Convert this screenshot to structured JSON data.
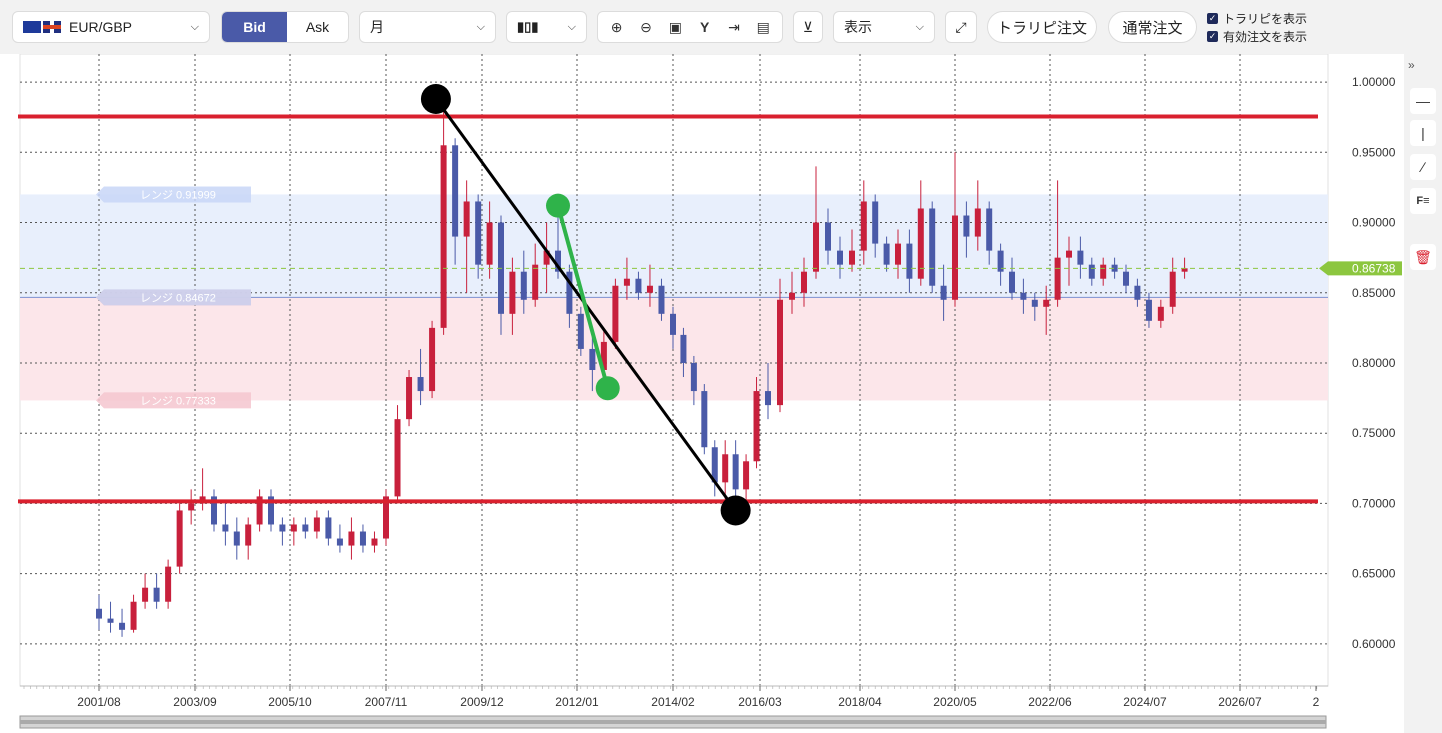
{
  "toolbar": {
    "symbol": "EUR/GBP",
    "bid_label": "Bid",
    "ask_label": "Ask",
    "period": "月",
    "display_label": "表示",
    "trap_order_label": "トラリピ注文",
    "normal_order_label": "通常注文",
    "show_trap_label": "トラリピを表示",
    "show_active_orders_label": "有効注文を表示",
    "show_trap_checked": true,
    "show_active_orders_checked": true
  },
  "colors": {
    "up_candle": "#c8203c",
    "down_candle": "#4a5aa8",
    "horizontal_line": "#d9202e",
    "trend_line": "#000000",
    "green_line": "#2fb34a",
    "price_tag": "#8cc63f",
    "range_band_blue": "#e8effc",
    "range_band_pink": "#fce6ea"
  },
  "chart_data": {
    "type": "candlestick",
    "symbol": "EUR/GBP",
    "timeframe": "月",
    "ylim": [
      0.57,
      1.02
    ],
    "y_ticks": [
      "1.00000",
      "0.95000",
      "0.90000",
      "0.85000",
      "0.80000",
      "0.75000",
      "0.70000",
      "0.65000",
      "0.60000"
    ],
    "x_ticks": [
      "2001/08",
      "2003/09",
      "2005/10",
      "2007/11",
      "2009/12",
      "2012/01",
      "2014/02",
      "2016/03",
      "2018/04",
      "2020/05",
      "2022/06",
      "2024/07",
      "2026/07",
      "2"
    ],
    "current_price": "0.86738",
    "range_labels": [
      {
        "text": "レンジ 0.91999",
        "value": 0.91999
      },
      {
        "text": "レンジ 0.84660",
        "value": 0.8466
      },
      {
        "text": "レンジ 0.84672",
        "value": 0.84672
      },
      {
        "text": "レンジ 0.77333",
        "value": 0.77333
      }
    ],
    "range_bands": [
      {
        "from": 0.8466,
        "to": 0.91999,
        "color": "blue"
      },
      {
        "from": 0.77333,
        "to": 0.8466,
        "color": "pink"
      }
    ],
    "horizontal_lines": [
      0.9755,
      0.7015
    ],
    "trend_lines": [
      {
        "from": [
          "2008/12",
          0.988
        ],
        "to": [
          "2015/08",
          0.695
        ],
        "color": "black",
        "end_markers": true
      },
      {
        "from": [
          "2011/08",
          0.912
        ],
        "to": [
          "2012/09",
          0.782
        ],
        "color": "green",
        "end_markers": true
      }
    ],
    "series": [
      {
        "name": "EUR/GBP",
        "ohlc": [
          [
            "2001/08",
            0.625,
            0.635,
            0.61,
            0.618
          ],
          [
            "2001/11",
            0.618,
            0.63,
            0.608,
            0.615
          ],
          [
            "2002/02",
            0.615,
            0.625,
            0.605,
            0.61
          ],
          [
            "2002/05",
            0.61,
            0.635,
            0.608,
            0.63
          ],
          [
            "2002/08",
            0.63,
            0.65,
            0.625,
            0.64
          ],
          [
            "2002/11",
            0.64,
            0.65,
            0.625,
            0.63
          ],
          [
            "2003/02",
            0.63,
            0.66,
            0.625,
            0.655
          ],
          [
            "2003/05",
            0.655,
            0.7,
            0.65,
            0.695
          ],
          [
            "2003/08",
            0.695,
            0.71,
            0.685,
            0.7
          ],
          [
            "2003/11",
            0.7,
            0.725,
            0.695,
            0.705
          ],
          [
            "2004/02",
            0.705,
            0.71,
            0.68,
            0.685
          ],
          [
            "2004/05",
            0.685,
            0.7,
            0.67,
            0.68
          ],
          [
            "2004/08",
            0.68,
            0.69,
            0.66,
            0.67
          ],
          [
            "2004/11",
            0.67,
            0.69,
            0.66,
            0.685
          ],
          [
            "2005/02",
            0.685,
            0.71,
            0.68,
            0.705
          ],
          [
            "2005/05",
            0.705,
            0.71,
            0.68,
            0.685
          ],
          [
            "2005/08",
            0.685,
            0.69,
            0.67,
            0.68
          ],
          [
            "2005/11",
            0.68,
            0.69,
            0.67,
            0.685
          ],
          [
            "2006/02",
            0.685,
            0.69,
            0.675,
            0.68
          ],
          [
            "2006/05",
            0.68,
            0.695,
            0.675,
            0.69
          ],
          [
            "2006/08",
            0.69,
            0.695,
            0.67,
            0.675
          ],
          [
            "2006/11",
            0.675,
            0.685,
            0.665,
            0.67
          ],
          [
            "2007/02",
            0.67,
            0.69,
            0.66,
            0.68
          ],
          [
            "2007/05",
            0.68,
            0.685,
            0.665,
            0.67
          ],
          [
            "2007/08",
            0.67,
            0.68,
            0.665,
            0.675
          ],
          [
            "2007/11",
            0.675,
            0.71,
            0.67,
            0.705
          ],
          [
            "2008/02",
            0.705,
            0.77,
            0.7,
            0.76
          ],
          [
            "2008/05",
            0.76,
            0.795,
            0.755,
            0.79
          ],
          [
            "2008/08",
            0.79,
            0.81,
            0.77,
            0.78
          ],
          [
            "2008/11",
            0.78,
            0.83,
            0.775,
            0.825
          ],
          [
            "2009/02",
            0.825,
            0.98,
            0.82,
            0.955
          ],
          [
            "2009/05",
            0.955,
            0.96,
            0.87,
            0.89
          ],
          [
            "2009/08",
            0.89,
            0.93,
            0.85,
            0.915
          ],
          [
            "2009/11",
            0.915,
            0.92,
            0.86,
            0.87
          ],
          [
            "2010/02",
            0.87,
            0.915,
            0.86,
            0.9
          ],
          [
            "2010/05",
            0.9,
            0.905,
            0.82,
            0.835
          ],
          [
            "2010/08",
            0.835,
            0.875,
            0.82,
            0.865
          ],
          [
            "2010/11",
            0.865,
            0.88,
            0.835,
            0.845
          ],
          [
            "2011/02",
            0.845,
            0.885,
            0.84,
            0.87
          ],
          [
            "2011/05",
            0.87,
            0.9,
            0.85,
            0.88
          ],
          [
            "2011/08",
            0.88,
            0.91,
            0.86,
            0.865
          ],
          [
            "2011/11",
            0.865,
            0.87,
            0.825,
            0.835
          ],
          [
            "2012/02",
            0.835,
            0.84,
            0.805,
            0.81
          ],
          [
            "2012/05",
            0.81,
            0.82,
            0.78,
            0.795
          ],
          [
            "2012/08",
            0.795,
            0.825,
            0.79,
            0.815
          ],
          [
            "2012/11",
            0.815,
            0.86,
            0.81,
            0.855
          ],
          [
            "2013/02",
            0.855,
            0.875,
            0.845,
            0.86
          ],
          [
            "2013/05",
            0.86,
            0.865,
            0.845,
            0.85
          ],
          [
            "2013/08",
            0.85,
            0.87,
            0.84,
            0.855
          ],
          [
            "2013/11",
            0.855,
            0.86,
            0.83,
            0.835
          ],
          [
            "2014/02",
            0.835,
            0.84,
            0.81,
            0.82
          ],
          [
            "2014/05",
            0.82,
            0.825,
            0.79,
            0.8
          ],
          [
            "2014/08",
            0.8,
            0.805,
            0.77,
            0.78
          ],
          [
            "2014/11",
            0.78,
            0.785,
            0.735,
            0.74
          ],
          [
            "2015/02",
            0.74,
            0.745,
            0.705,
            0.715
          ],
          [
            "2015/05",
            0.715,
            0.745,
            0.7,
            0.735
          ],
          [
            "2015/08",
            0.735,
            0.745,
            0.695,
            0.71
          ],
          [
            "2015/11",
            0.71,
            0.735,
            0.7,
            0.73
          ],
          [
            "2016/02",
            0.73,
            0.79,
            0.725,
            0.78
          ],
          [
            "2016/05",
            0.78,
            0.8,
            0.76,
            0.77
          ],
          [
            "2016/08",
            0.77,
            0.86,
            0.765,
            0.845
          ],
          [
            "2016/11",
            0.845,
            0.865,
            0.835,
            0.85
          ],
          [
            "2017/02",
            0.85,
            0.875,
            0.84,
            0.865
          ],
          [
            "2017/05",
            0.865,
            0.94,
            0.86,
            0.9
          ],
          [
            "2017/08",
            0.9,
            0.91,
            0.87,
            0.88
          ],
          [
            "2017/11",
            0.88,
            0.89,
            0.86,
            0.87
          ],
          [
            "2018/02",
            0.87,
            0.895,
            0.865,
            0.88
          ],
          [
            "2018/05",
            0.88,
            0.93,
            0.87,
            0.915
          ],
          [
            "2018/08",
            0.915,
            0.92,
            0.875,
            0.885
          ],
          [
            "2018/11",
            0.885,
            0.89,
            0.865,
            0.87
          ],
          [
            "2019/02",
            0.87,
            0.895,
            0.86,
            0.885
          ],
          [
            "2019/05",
            0.885,
            0.895,
            0.85,
            0.86
          ],
          [
            "2019/08",
            0.86,
            0.93,
            0.855,
            0.91
          ],
          [
            "2019/11",
            0.91,
            0.915,
            0.85,
            0.855
          ],
          [
            "2020/02",
            0.855,
            0.87,
            0.83,
            0.845
          ],
          [
            "2020/05",
            0.845,
            0.95,
            0.84,
            0.905
          ],
          [
            "2020/08",
            0.905,
            0.915,
            0.875,
            0.89
          ],
          [
            "2020/11",
            0.89,
            0.93,
            0.88,
            0.91
          ],
          [
            "2021/02",
            0.91,
            0.915,
            0.87,
            0.88
          ],
          [
            "2021/05",
            0.88,
            0.885,
            0.855,
            0.865
          ],
          [
            "2021/08",
            0.865,
            0.875,
            0.845,
            0.85
          ],
          [
            "2021/11",
            0.85,
            0.86,
            0.835,
            0.845
          ],
          [
            "2022/02",
            0.845,
            0.85,
            0.83,
            0.84
          ],
          [
            "2022/05",
            0.84,
            0.855,
            0.82,
            0.845
          ],
          [
            "2022/08",
            0.845,
            0.93,
            0.84,
            0.875
          ],
          [
            "2022/11",
            0.875,
            0.89,
            0.855,
            0.88
          ],
          [
            "2023/02",
            0.88,
            0.89,
            0.86,
            0.87
          ],
          [
            "2023/05",
            0.87,
            0.875,
            0.855,
            0.86
          ],
          [
            "2023/08",
            0.86,
            0.875,
            0.855,
            0.87
          ],
          [
            "2023/11",
            0.87,
            0.875,
            0.86,
            0.865
          ],
          [
            "2024/02",
            0.865,
            0.87,
            0.85,
            0.855
          ],
          [
            "2024/05",
            0.855,
            0.86,
            0.84,
            0.845
          ],
          [
            "2024/08",
            0.845,
            0.85,
            0.825,
            0.83
          ],
          [
            "2024/11",
            0.83,
            0.845,
            0.825,
            0.84
          ],
          [
            "2025/02",
            0.84,
            0.875,
            0.835,
            0.865
          ],
          [
            "2025/05",
            0.865,
            0.875,
            0.86,
            0.8674
          ]
        ]
      }
    ]
  }
}
